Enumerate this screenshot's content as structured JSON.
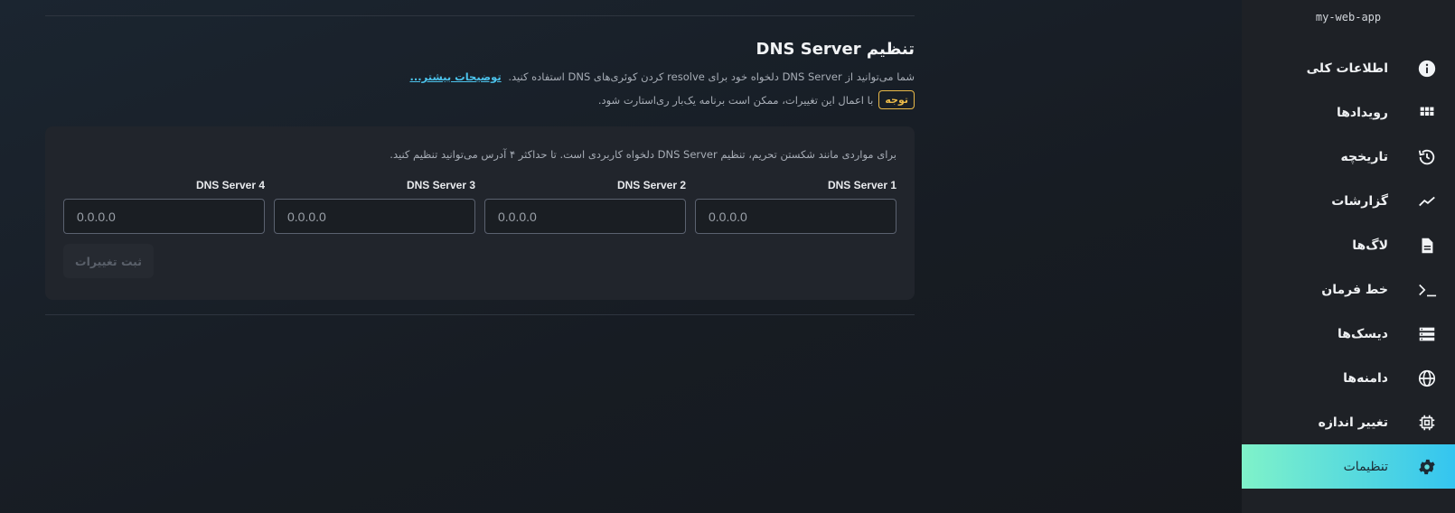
{
  "app_name": "my-web-app",
  "sidebar": {
    "items": [
      {
        "label": "اطلاعات کلی",
        "icon": "info-icon"
      },
      {
        "label": "رویدادها",
        "icon": "grid-icon"
      },
      {
        "label": "تاریخچه",
        "icon": "history-icon"
      },
      {
        "label": "گزارشات",
        "icon": "chart-line-icon"
      },
      {
        "label": "لاگ‌ها",
        "icon": "file-icon"
      },
      {
        "label": "خط فرمان",
        "icon": "terminal-icon"
      },
      {
        "label": "دیسک‌ها",
        "icon": "server-icon"
      },
      {
        "label": "دامنه‌ها",
        "icon": "globe-icon"
      },
      {
        "label": "تغییر اندازه",
        "icon": "chip-icon"
      },
      {
        "label": "تنظیمات",
        "icon": "gear-icon",
        "active": true
      }
    ]
  },
  "section": {
    "title": "تنظیم DNS Server",
    "description": "شما می‌توانید از DNS Server دلخواه خود برای resolve کردن کوئری‌های DNS استفاده کنید.",
    "more_link": "توضیحات بیشتر...",
    "note_badge": "توجه",
    "note_text": "با اعمال این تغییرات، ممکن است برنامه یک‌بار ری‌استارت شود."
  },
  "card": {
    "description": "برای مواردی مانند شکستن تحریم، تنظیم DNS Server دلخواه کاربردی است. تا حداکثر ۴ آدرس می‌توانید تنظیم کنید.",
    "fields": [
      {
        "label": "DNS Server 1",
        "placeholder": "0.0.0.0"
      },
      {
        "label": "DNS Server 2",
        "placeholder": "0.0.0.0"
      },
      {
        "label": "DNS Server 3",
        "placeholder": "0.0.0.0"
      },
      {
        "label": "DNS Server 4",
        "placeholder": "0.0.0.0"
      }
    ],
    "submit_label": "ثبت تغییرات"
  },
  "colors": {
    "accent_start": "#7ff2c9",
    "accent_end": "#34c5f0",
    "warning": "#e9b949",
    "link": "#4cc3ec"
  }
}
